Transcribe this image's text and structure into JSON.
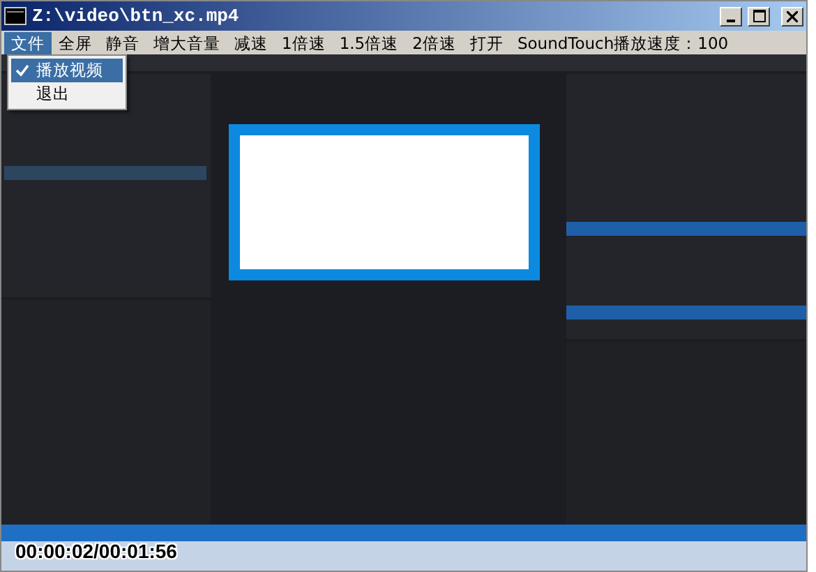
{
  "window": {
    "title": "Z:\\video\\btn_xc.mp4"
  },
  "menu_bar": [
    {
      "label": "文件",
      "selected": true
    },
    {
      "label": "全屏",
      "selected": false
    },
    {
      "label": "静音",
      "selected": false
    },
    {
      "label": "增大音量",
      "selected": false
    },
    {
      "label": "减速",
      "selected": false
    },
    {
      "label": "1倍速",
      "selected": false
    },
    {
      "label": "1.5倍速",
      "selected": false
    },
    {
      "label": "2倍速",
      "selected": false
    },
    {
      "label": "打开",
      "selected": false
    },
    {
      "label": "SoundTouch播放速度：100",
      "selected": false
    }
  ],
  "file_menu": [
    {
      "label": "播放视频",
      "checked": true,
      "selected": true
    },
    {
      "label": "退出",
      "checked": false,
      "selected": false
    }
  ],
  "video": {
    "timecode": "00:00:02/00:01:56"
  }
}
